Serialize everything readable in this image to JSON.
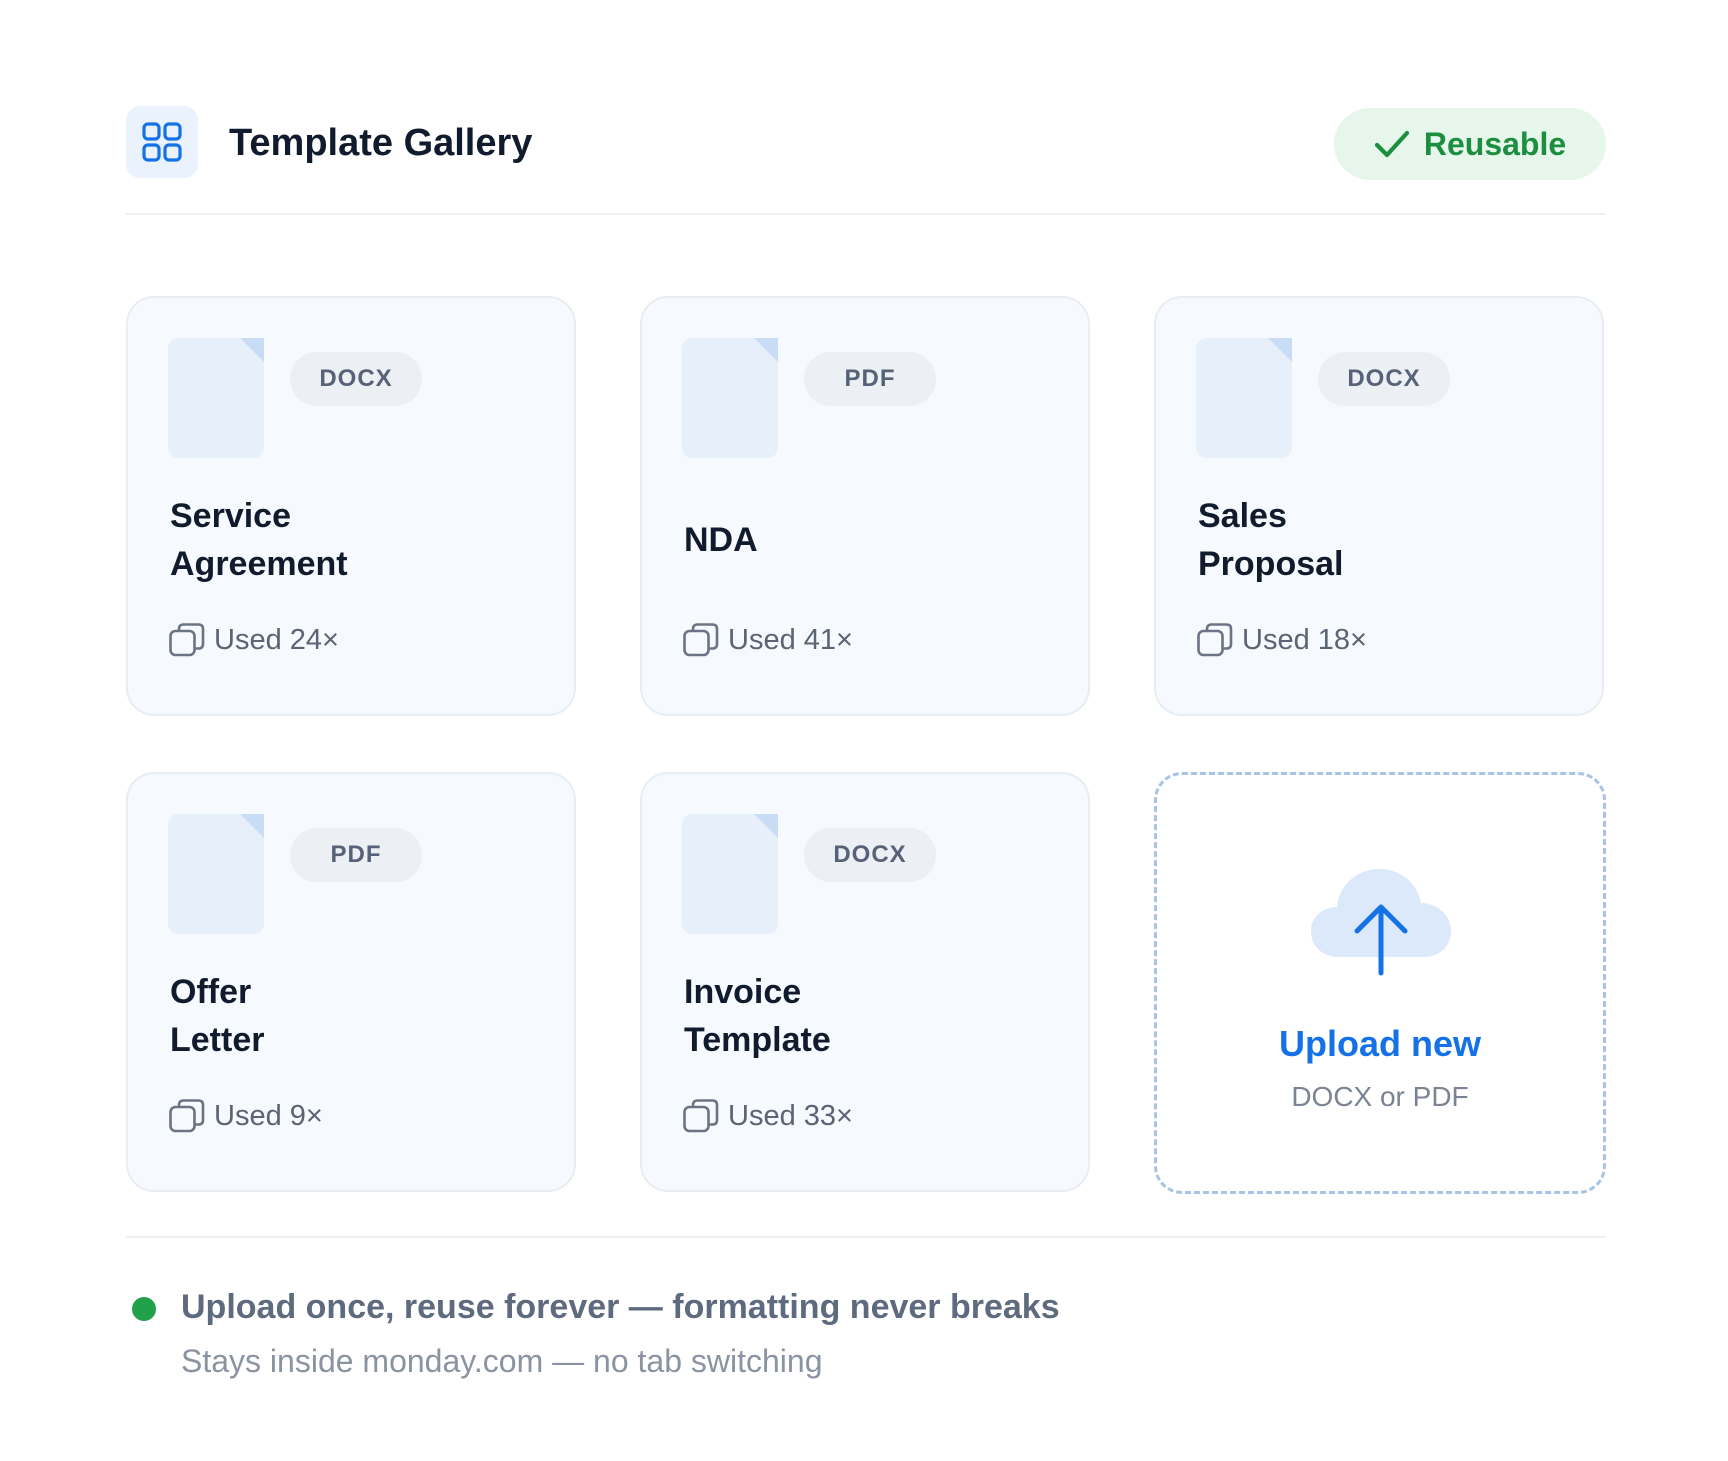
{
  "header": {
    "title": "Template Gallery",
    "logo_icon": "grid-icon",
    "badge": {
      "icon": "checkmark-icon",
      "label": "Reusable"
    }
  },
  "templates": [
    {
      "type": "DOCX",
      "title_lines": [
        "Service",
        "Agreement"
      ],
      "usage": "Used 24×"
    },
    {
      "type": "PDF",
      "title_lines": [
        "NDA"
      ],
      "usage": "Used 41×"
    },
    {
      "type": "DOCX",
      "title_lines": [
        "Sales",
        "Proposal"
      ],
      "usage": "Used 18×"
    },
    {
      "type": "PDF",
      "title_lines": [
        "Offer",
        "Letter"
      ],
      "usage": "Used 9×"
    },
    {
      "type": "DOCX",
      "title_lines": [
        "Invoice",
        "Template"
      ],
      "usage": "Used 33×"
    }
  ],
  "upload": {
    "icon": "cloud-upload-icon",
    "title": "Upload new",
    "subtitle": "DOCX or PDF"
  },
  "footer": {
    "headline": "Upload once, reuse forever — formatting never breaks",
    "subline": "Stays inside monday.com — no tab switching"
  },
  "colors": {
    "accent": "#1572e6",
    "success": "#1b8f3f",
    "success_bg": "#e6f6ea",
    "status_dot": "#21a04a"
  }
}
